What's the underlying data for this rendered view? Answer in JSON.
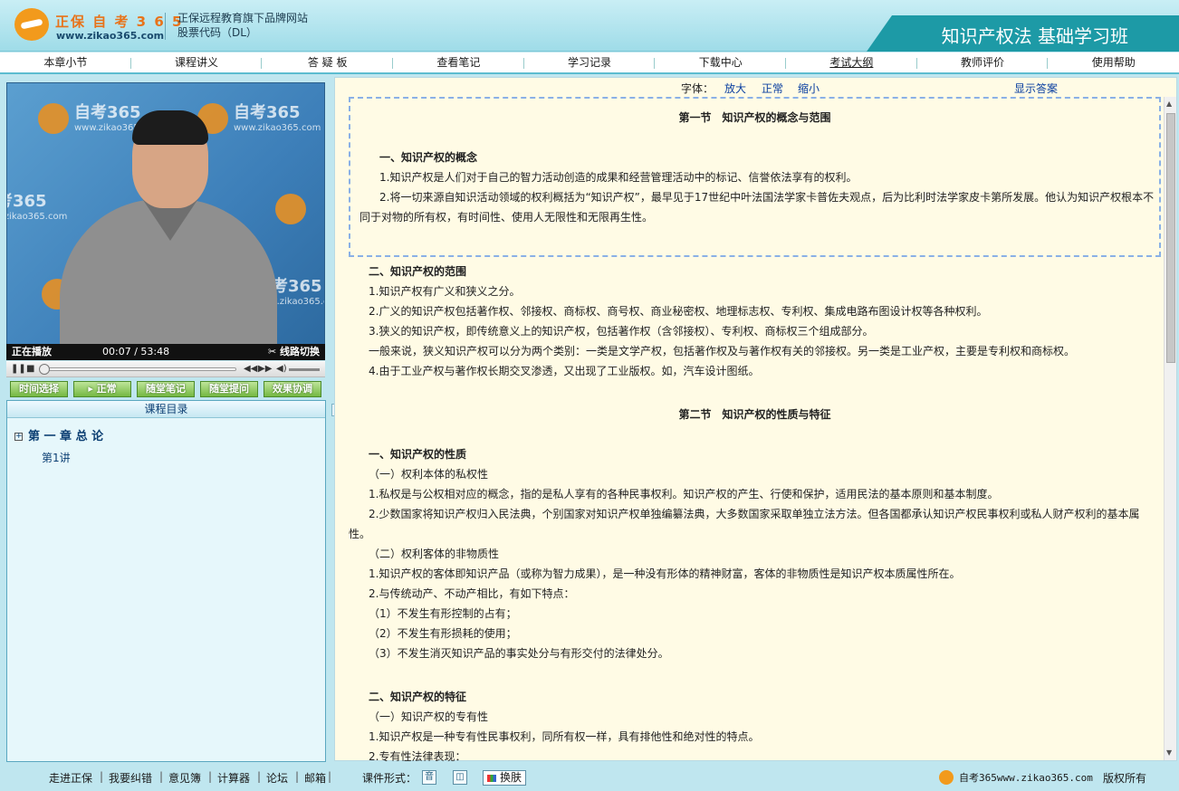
{
  "header": {
    "brand": "正保 自 考 3 6 5",
    "url": "www.zikao365.com",
    "tagline_1": "正保远程教育旗下品牌网站",
    "tagline_2": "股票代码（DL）",
    "course_title": "知识产权法 基础学习班"
  },
  "nav": [
    "本章小节",
    "课程讲义",
    "答 疑 板",
    "查看笔记",
    "学习记录",
    "下载中心",
    "考试大纲",
    "教师评价",
    "使用帮助"
  ],
  "video": {
    "watermark_text": "自考365",
    "watermark_url": "www.zikao365.com",
    "status": "正在播放",
    "time": "00:07 / 53:48",
    "line_switch": "线路切换"
  },
  "video_buttons": [
    "时间选择",
    "正常",
    "随堂笔记",
    "随堂提问",
    "效果协调"
  ],
  "catalog": {
    "title": "课程目录",
    "chapter": "第 一 章 总 论",
    "lesson": "第1讲"
  },
  "font_bar": {
    "label": "字体：",
    "enlarge": "放大",
    "normal": "正常",
    "shrink": "缩小",
    "show_answer": "显示答案"
  },
  "content": {
    "s1_title": "第一节　知识产权的概念与范围",
    "s1_h1": "一、知识产权的概念",
    "s1_p1": "1.知识产权是人们对于自己的智力活动创造的成果和经营管理活动中的标记、信誉依法享有的权利。",
    "s1_p2": "2.将一切来源自知识活动领域的权利概括为“知识产权”，最早见于17世纪中叶法国法学家卡普佐夫观点，后为比利时法学家皮卡第所发展。他认为知识产权根本不同于对物的所有权，有时间性、使用人无限性和无限再生性。",
    "s1_h2": "二、知识产权的范围",
    "s1_p3": "1.知识产权有广义和狭义之分。",
    "s1_p4": "2.广义的知识产权包括著作权、邻接权、商标权、商号权、商业秘密权、地理标志权、专利权、集成电路布图设计权等各种权利。",
    "s1_p5": "3.狭义的知识产权，即传统意义上的知识产权，包括著作权（含邻接权）、专利权、商标权三个组成部分。",
    "s1_p6": "一般来说，狭义知识产权可以分为两个类别：一类是文学产权，包括著作权及与著作权有关的邻接权。另一类是工业产权，主要是专利权和商标权。",
    "s1_p7": "4.由于工业产权与著作权长期交叉渗透，又出现了工业版权。如，汽车设计图纸。",
    "s2_title": "第二节　知识产权的性质与特征",
    "s2_h1": "一、知识产权的性质",
    "s2_sub1": "（一）权利本体的私权性",
    "s2_p1": "1.私权是与公权相对应的概念，指的是私人享有的各种民事权利。知识产权的产生、行使和保护，适用民法的基本原则和基本制度。",
    "s2_p2": "2.少数国家将知识产权归入民法典，个别国家对知识产权单独编纂法典，大多数国家采取单独立法方法。但各国都承认知识产权民事权利或私人财产权利的基本属性。",
    "s2_sub2": "（二）权利客体的非物质性",
    "s2_p3": "1.知识产权的客体即知识产品（或称为智力成果），是一种没有形体的精神财富，客体的非物质性是知识产权本质属性所在。",
    "s2_p4": "2.与传统动产、不动产相比，有如下特点：",
    "s2_p5": "（1）不发生有形控制的占有；",
    "s2_p6": "（2）不发生有形损耗的使用；",
    "s2_p7": "（3）不发生消灭知识产品的事实处分与有形交付的法律处分。",
    "s2_h2": "二、知识产权的特征",
    "s2_sub3": "（一）知识产权的专有性",
    "s2_p8": "1.知识产权是一种专有性民事权利，同所有权一样，具有排他性和绝对性的特点。",
    "s2_p9": "2.专有性法律表现："
  },
  "footer": {
    "links": [
      "走进正保",
      "我要纠错",
      "意见簿",
      "计算器",
      "论坛",
      "邮箱"
    ],
    "mode_label": "课件形式：",
    "mode_audio": "音",
    "skin": "换肤",
    "site": "自考365www.zikao365.com",
    "copyright": "版权所有"
  },
  "colors": {
    "header_bg": "#bfe6ef",
    "banner": "#1d9aa6",
    "content_bg": "#fffbe5",
    "link_blue": "#0a3fa0",
    "button_green": "#74b842"
  }
}
